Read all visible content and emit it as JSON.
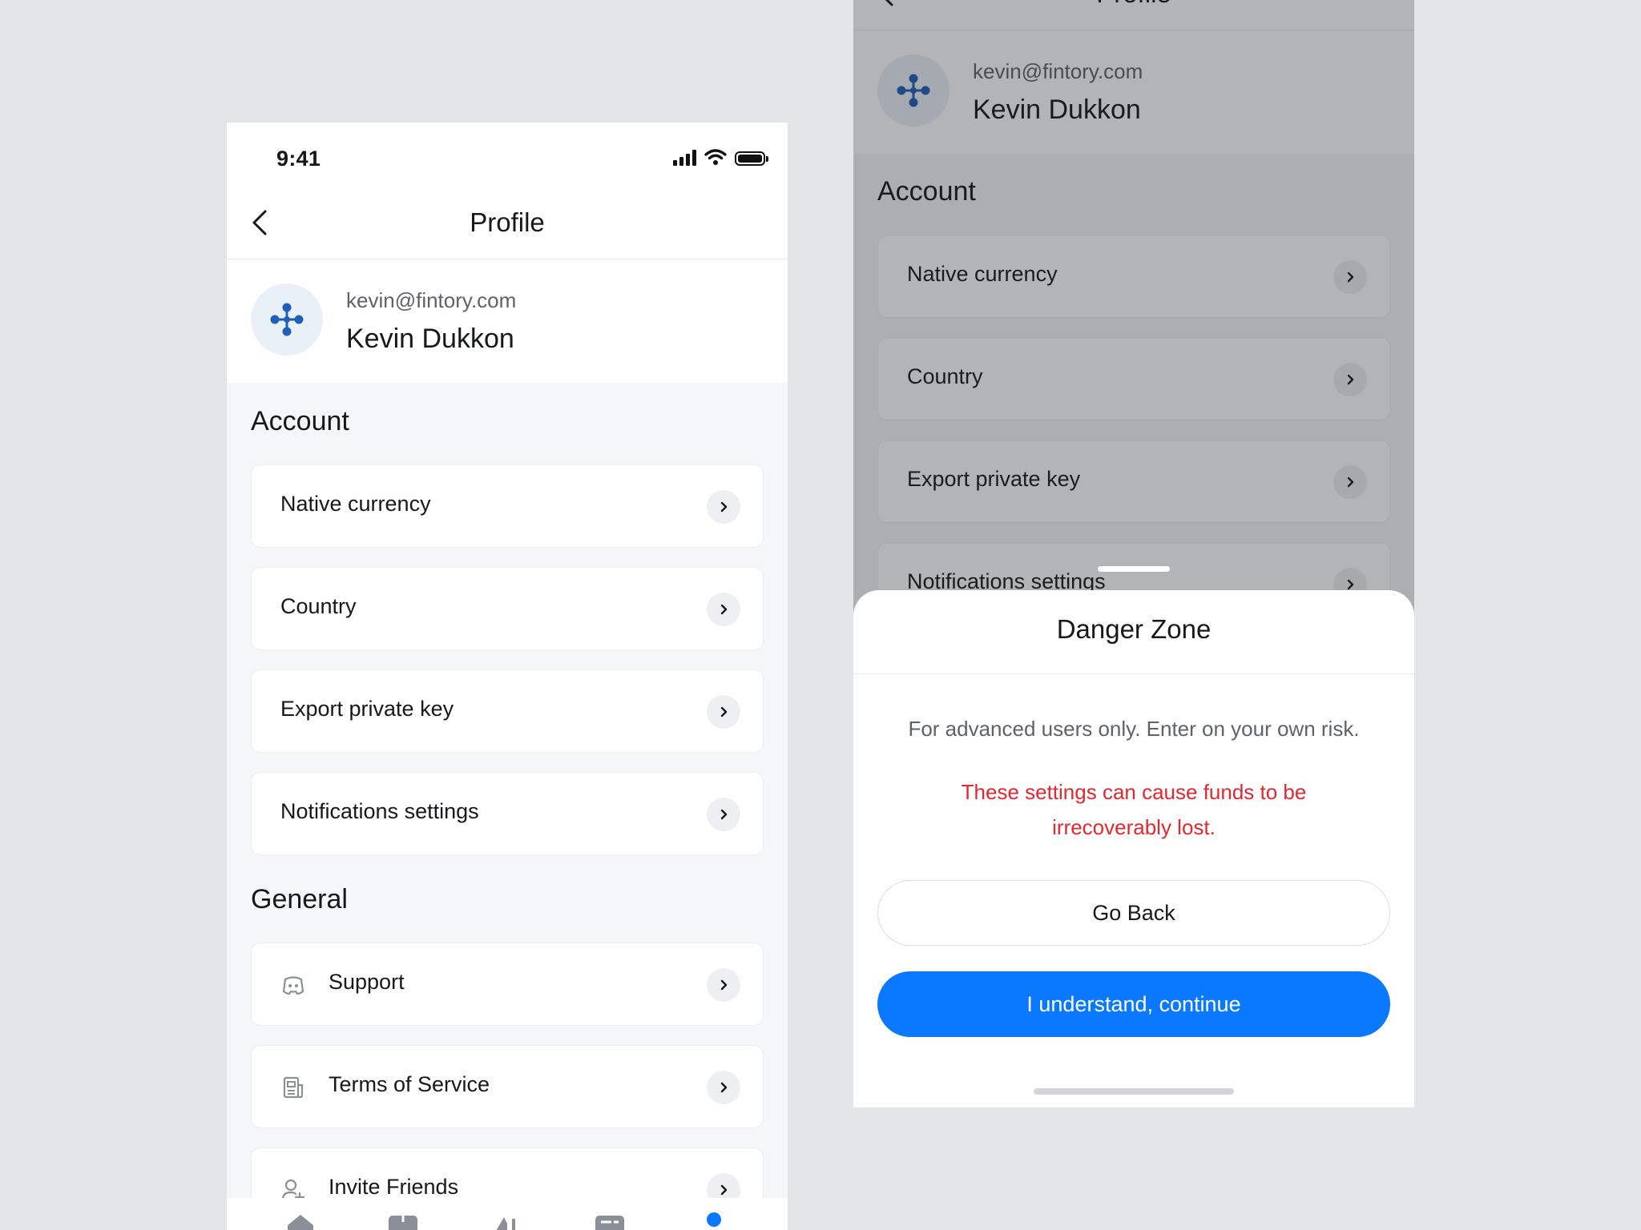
{
  "left_screen": {
    "status": {
      "time": "9:41"
    },
    "nav": {
      "title": "Profile",
      "back_icon": "chevron-left-icon"
    },
    "profile": {
      "email": "kevin@fintory.com",
      "name": "Kevin Dukkon"
    },
    "account": {
      "title": "Account",
      "items": [
        {
          "label": "Native currency"
        },
        {
          "label": "Country"
        },
        {
          "label": "Export private key"
        },
        {
          "label": "Notifications settings"
        }
      ]
    },
    "general": {
      "title": "General",
      "items": [
        {
          "label": "Support",
          "icon": "discord-icon"
        },
        {
          "label": "Terms of Service",
          "icon": "document-icon"
        },
        {
          "label": "Invite Friends",
          "icon": "add-user-icon"
        }
      ]
    },
    "tabbar": {
      "tabs": [
        "home-icon",
        "wallet-icon",
        "chart-icon",
        "list-icon",
        "profile-icon"
      ],
      "active": "profile-icon"
    }
  },
  "right_screen": {
    "nav": {
      "title": "Profile"
    },
    "profile": {
      "email": "kevin@fintory.com",
      "name": "Kevin Dukkon"
    },
    "account": {
      "title": "Account",
      "items": [
        {
          "label": "Native currency"
        },
        {
          "label": "Country"
        },
        {
          "label": "Export private key"
        },
        {
          "label": "Notifications settings"
        }
      ]
    },
    "sheet": {
      "title": "Danger Zone",
      "description": "For advanced users only. Enter on your own risk.",
      "warning": "These settings can cause funds to be irrecoverably lost.",
      "back_label": "Go Back",
      "continue_label": "I understand, continue"
    }
  },
  "colors": {
    "background": "#e3e4e8",
    "accent": "#0a79ff",
    "danger": "#e5282f",
    "brand_icon": "#1e5fb8"
  }
}
